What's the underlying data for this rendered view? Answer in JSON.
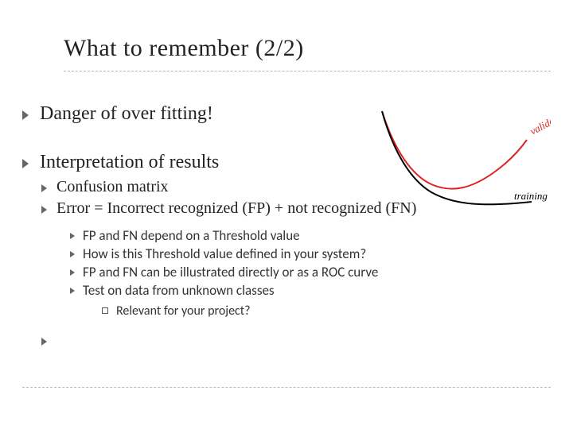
{
  "title": "What to remember (2/2)",
  "bullets": {
    "level1": [
      "Danger of over fitting!",
      "Interpretation of results"
    ],
    "level2": [
      "Confusion matrix",
      "Error = Incorrect recognized (FP) + not recognized (FN)"
    ],
    "level3": [
      "FP and FN depend on a Threshold value",
      "How is this Threshold value defined in your system?",
      "FP and FN can be illustrated directly or as a ROC curve",
      "Test on data from unknown classes"
    ],
    "level4": [
      "Relevant for your project?"
    ]
  },
  "figure": {
    "labels": {
      "validation": "validation",
      "training": "training"
    },
    "colors": {
      "validation": "#d22",
      "training": "#000"
    }
  },
  "chart_data": {
    "type": "line",
    "title": "",
    "xlabel": "",
    "ylabel": "",
    "xlim": [
      0,
      10
    ],
    "ylim": [
      0,
      10
    ],
    "series": [
      {
        "name": "validation",
        "x": [
          0,
          1,
          2,
          3,
          4,
          5,
          6,
          7,
          8,
          9,
          10
        ],
        "y": [
          9.5,
          6.8,
          4.8,
          3.6,
          2.9,
          2.6,
          2.7,
          3.1,
          3.8,
          4.8,
          6.2
        ]
      },
      {
        "name": "training",
        "x": [
          0,
          1,
          2,
          3,
          4,
          5,
          6,
          7,
          8,
          9,
          10
        ],
        "y": [
          9.5,
          6.6,
          4.6,
          3.3,
          2.5,
          2.0,
          1.7,
          1.5,
          1.4,
          1.35,
          1.3
        ]
      }
    ]
  }
}
